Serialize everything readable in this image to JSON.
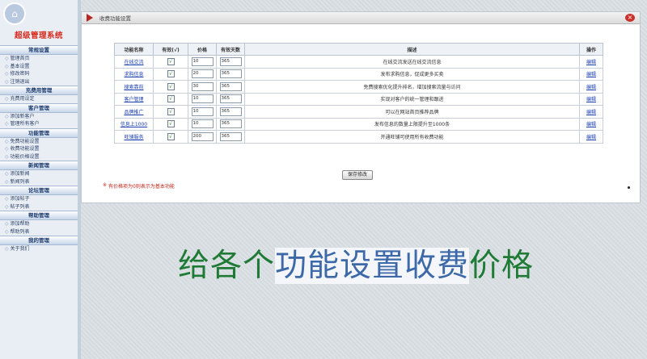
{
  "sidebar": {
    "title": "超级管理系统",
    "groups": [
      {
        "head": "常规设置",
        "items": [
          "管理首页",
          "基本设置",
          "修改密码",
          "注销退出"
        ]
      },
      {
        "head": "充费用管理",
        "items": [
          "充费用设定"
        ]
      },
      {
        "head": "客户管理",
        "items": [
          "添加新客户",
          "管理所有客户"
        ]
      },
      {
        "head": "功能管理",
        "items": [
          "免费功能设置",
          "收费功能设置",
          "功能价格设置"
        ]
      },
      {
        "head": "新闻管理",
        "items": [
          "添加新闻",
          "新闻列表"
        ]
      },
      {
        "head": "论坛管理",
        "items": [
          "添加帖子",
          "帖子列表"
        ]
      },
      {
        "head": "帮助管理",
        "items": [
          "添加帮助",
          "帮助列表"
        ]
      },
      {
        "head": "我的管理",
        "items": [
          "关于我们"
        ]
      }
    ]
  },
  "panel": {
    "title": "收费功能设置",
    "headers": [
      "功能名称",
      "有效(√)",
      "价格",
      "有效天数",
      "描述",
      "操作"
    ],
    "rows": [
      {
        "name": "在线交流",
        "enabled": "√",
        "price": "10",
        "days": "365",
        "desc": "在线交流发送在线交流信息",
        "op": "编辑"
      },
      {
        "name": "求购信息",
        "enabled": "√",
        "price": "20",
        "days": "365",
        "desc": "发布求购信息，促成更多买卖",
        "op": "编辑"
      },
      {
        "name": "搜索靠前",
        "enabled": "√",
        "price": "30",
        "days": "365",
        "desc": "免费搜索优化提升排名，增加搜索流量与访问",
        "op": "编辑"
      },
      {
        "name": "客户管理",
        "enabled": "√",
        "price": "10",
        "days": "365",
        "desc": "实现对客户的统一管理和跟进",
        "op": "编辑"
      },
      {
        "name": "品牌推广",
        "enabled": "√",
        "price": "10",
        "days": "365",
        "desc": "可以在网站首页推荐品牌",
        "op": "编辑"
      },
      {
        "name": "信息上1000",
        "enabled": "√",
        "price": "10",
        "days": "365",
        "desc": "发布信息的数量上限提升至1000条",
        "op": "编辑"
      },
      {
        "name": "旺铺服务",
        "enabled": "√",
        "price": "200",
        "days": "365",
        "desc": "开通旺铺可使用所有收费功能",
        "op": "编辑"
      }
    ],
    "save_label": "保存修改",
    "note_bullet": "※",
    "note": "有价格项为0则表示为基本功能"
  },
  "caption": {
    "part1": "给各个",
    "part2": "功能设置收费",
    "part3": "价格"
  },
  "colors": {
    "accent_red": "#c0261c",
    "link_blue": "#1a3fb0",
    "caption_green": "#1e7a34",
    "caption_blue": "#3d69a8"
  },
  "icons": {
    "logo": "logo-icon",
    "close": "close-icon",
    "flag": "flag-icon",
    "checkbox": "checkbox-checked-icon"
  }
}
